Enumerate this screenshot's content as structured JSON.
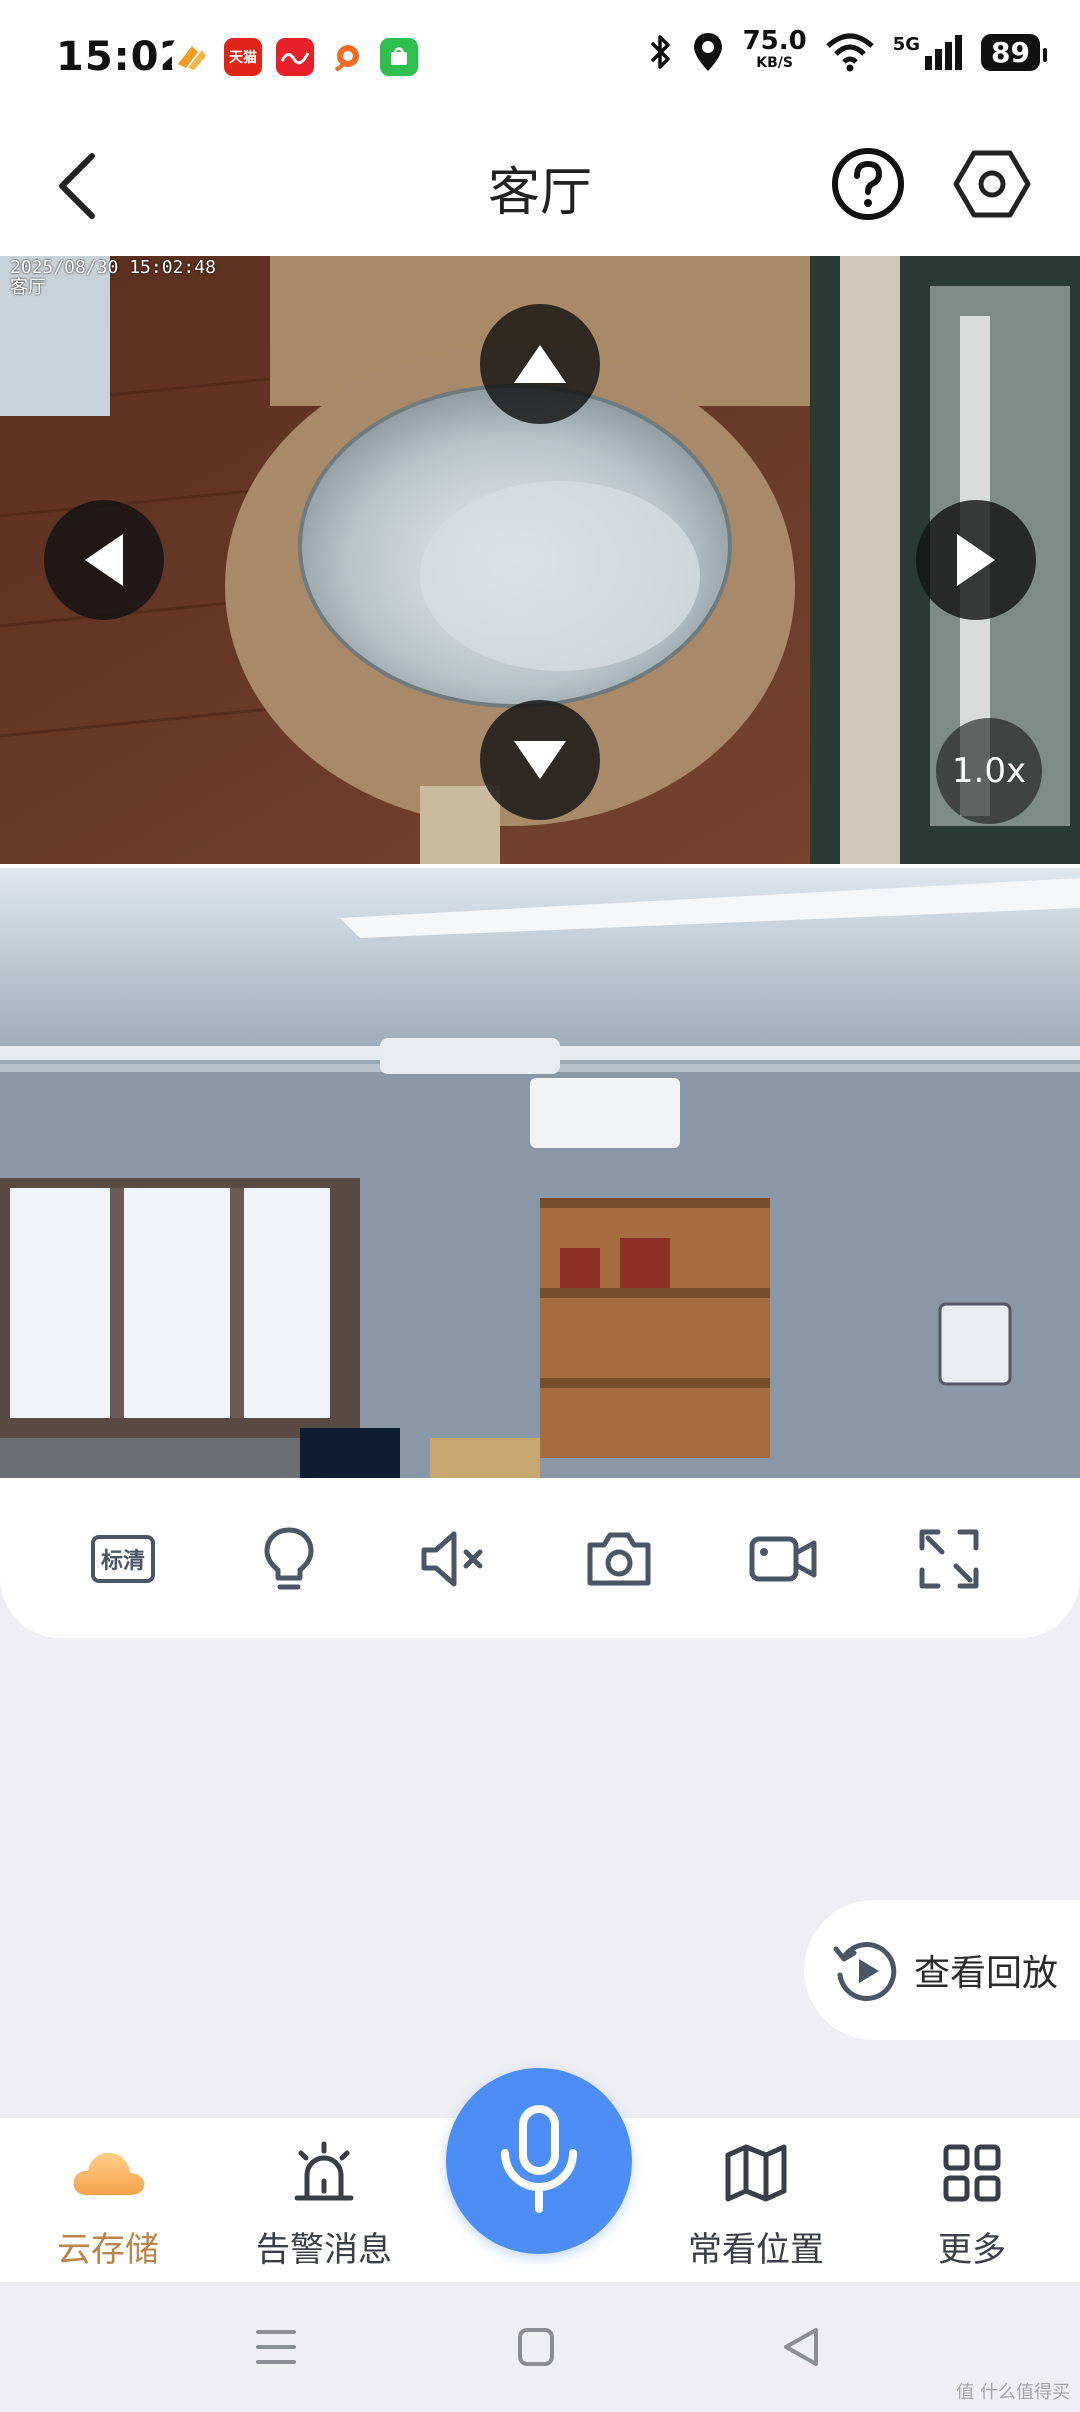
{
  "status_bar": {
    "time": "15:02",
    "net_speed_value": "75.0",
    "net_speed_unit": "KB/S",
    "network_label": "5G",
    "battery": "89",
    "app_icons": [
      "app-orange-icon",
      "tmall-icon",
      "app-red-icon",
      "app-orange-fish-icon",
      "app-green-icon"
    ],
    "tmall_label": "天猫"
  },
  "header": {
    "title": "客厅"
  },
  "camera": {
    "timestamp": "2025/08/30 15:02:48",
    "channel_name": "客厅",
    "zoom": "1.0x"
  },
  "toolbar": {
    "quality_label": "标清",
    "items": [
      "quality",
      "light",
      "mute",
      "snapshot",
      "record",
      "fullscreen"
    ]
  },
  "playback": {
    "label": "查看回放"
  },
  "bottom_nav": {
    "items": [
      {
        "id": "cloud",
        "label": "云存储",
        "icon": "cloud-icon"
      },
      {
        "id": "alarm",
        "label": "告警消息",
        "icon": "alarm-icon"
      },
      {
        "id": "positions",
        "label": "常看位置",
        "icon": "map-icon"
      },
      {
        "id": "more",
        "label": "更多",
        "icon": "grid-icon"
      }
    ],
    "active": "cloud"
  },
  "watermark": "值 什么值得买",
  "colors": {
    "accent_blue": "#4c8ef5",
    "active_gold": "#b8864a",
    "icon_gray": "#4a5566",
    "background": "#efeef3"
  }
}
